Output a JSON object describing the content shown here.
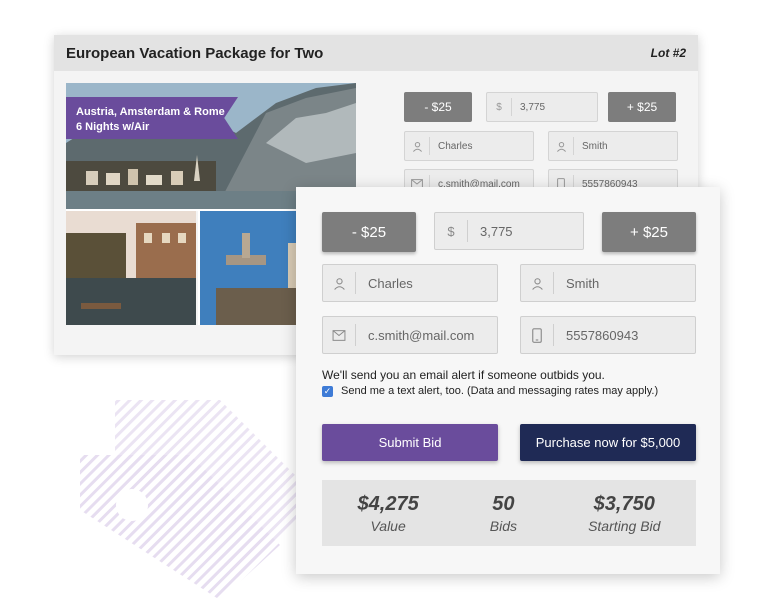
{
  "back_card": {
    "title": "European Vacation Package for Two",
    "lot": "Lot #2",
    "ribbon": {
      "line1": "Austria, Amsterdam & Rome",
      "line2": "6 Nights w/Air"
    },
    "bid": {
      "minus_label": "- $25",
      "currency": "$",
      "amount": "3,775",
      "plus_label": "+ $25"
    },
    "first_name": "Charles",
    "last_name": "Smith",
    "email": "c.smith@mail.com",
    "phone": "5557860943"
  },
  "front_card": {
    "bid": {
      "minus_label": "- $25",
      "currency": "$",
      "amount": "3,775",
      "plus_label": "+ $25"
    },
    "first_name": "Charles",
    "last_name": "Smith",
    "email": "c.smith@mail.com",
    "phone": "5557860943",
    "notice": "We'll send you an email alert if someone outbids you.",
    "text_alert_label": "Send me a text alert, too. (Data and messaging rates may apply.)",
    "text_alert_checked": true,
    "submit_label": "Submit Bid",
    "buy_label": "Purchase now for $5,000",
    "stats": [
      {
        "value": "$4,275",
        "label": "Value"
      },
      {
        "value": "50",
        "label": "Bids"
      },
      {
        "value": "$3,750",
        "label": "Starting Bid"
      }
    ]
  },
  "colors": {
    "purple": "#6a4c9c",
    "navy": "#1f2a55",
    "grey_button": "#7d7d7d",
    "checkbox": "#3e7bd6"
  },
  "icons": [
    "person-icon",
    "envelope-icon",
    "phone-icon",
    "dollar-icon",
    "check-icon"
  ]
}
